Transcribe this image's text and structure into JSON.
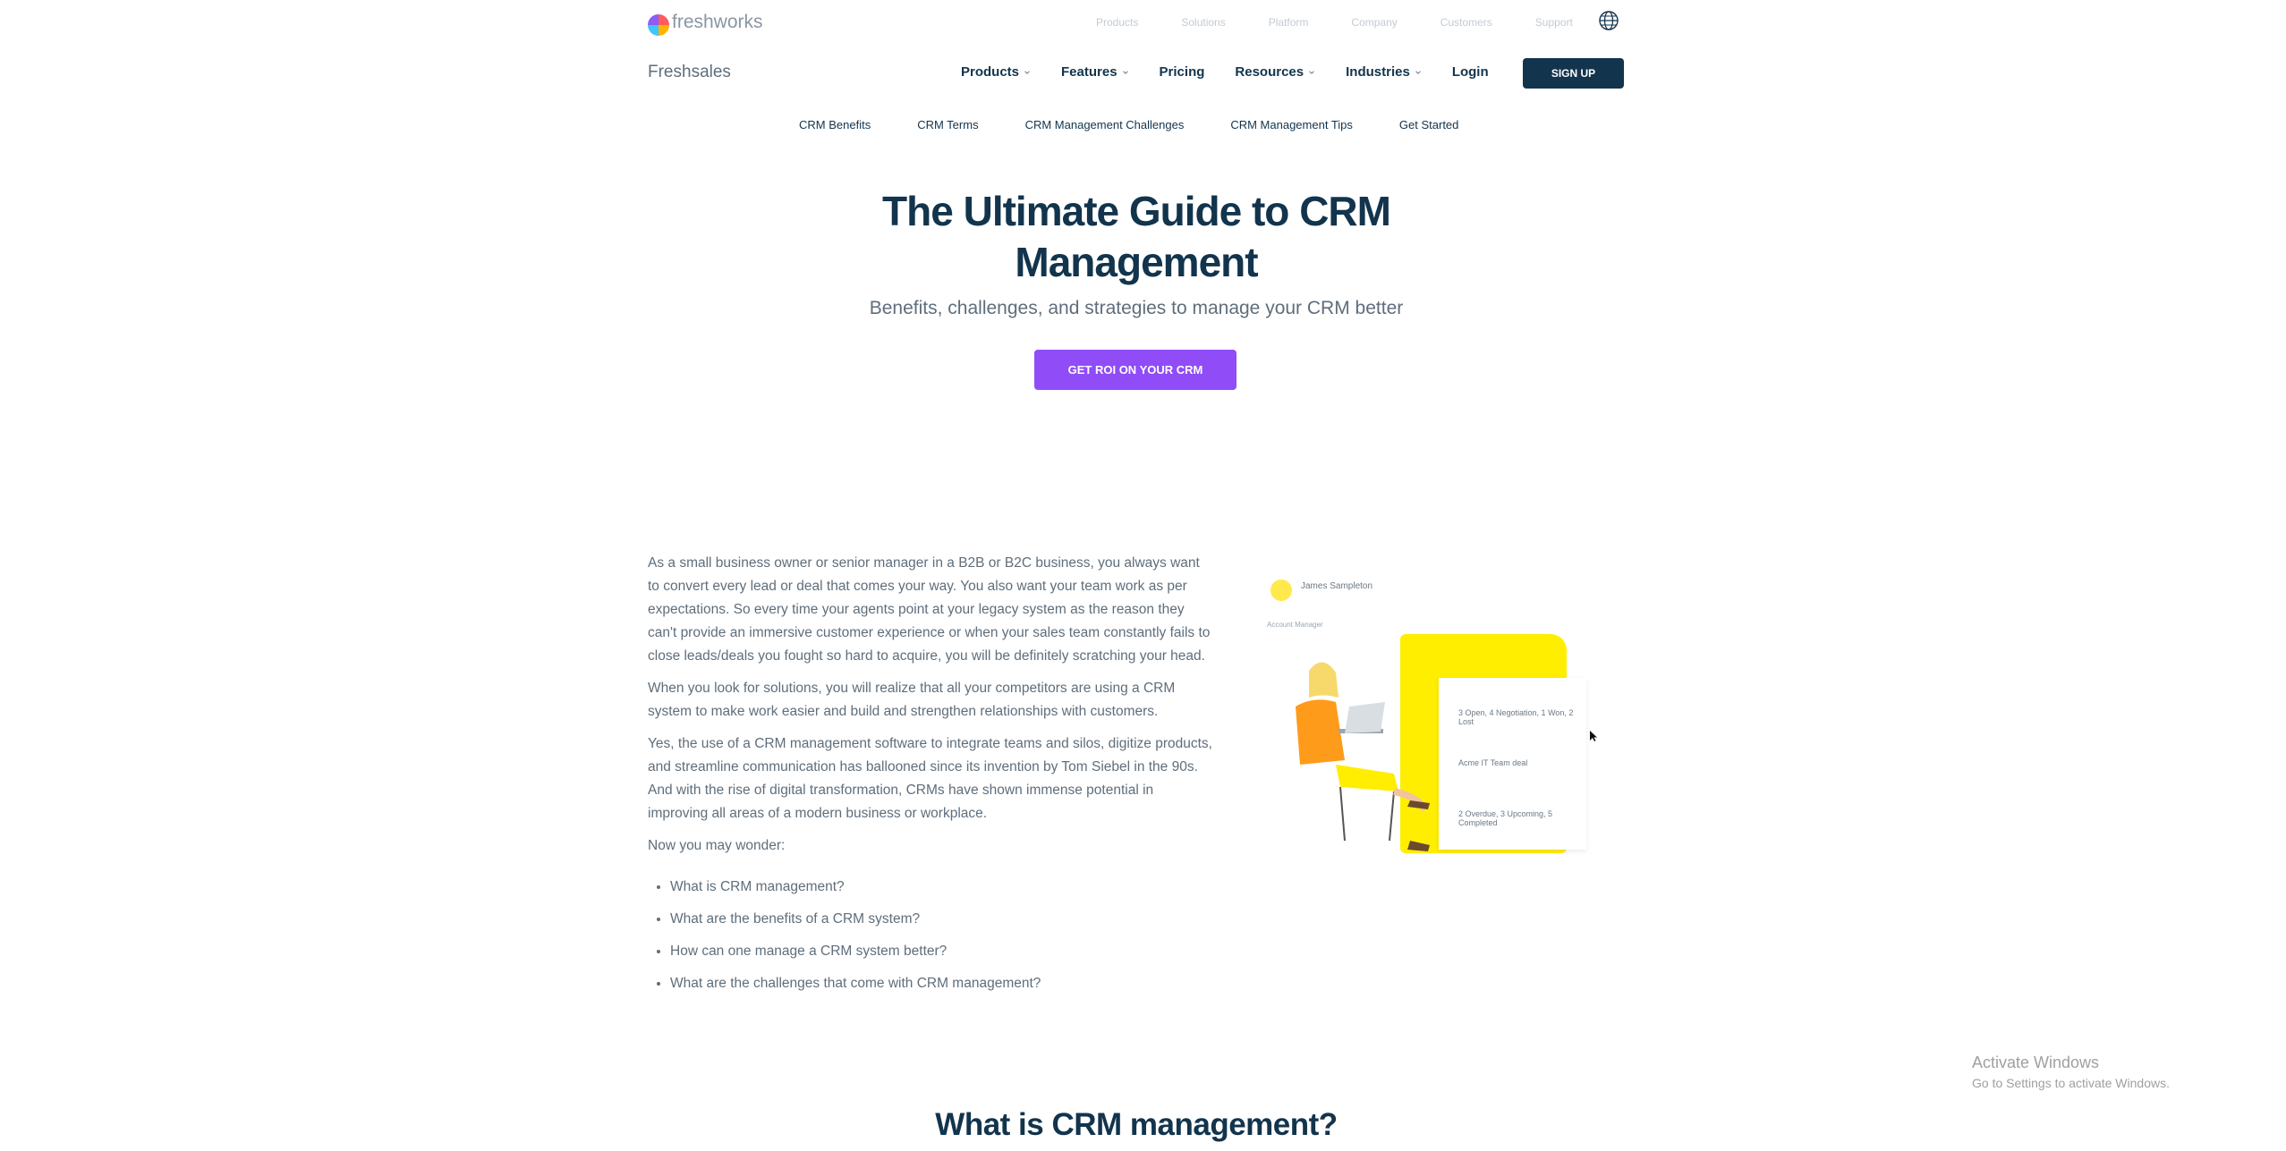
{
  "brand": {
    "name": "freshworks"
  },
  "utility_nav": [
    "Products",
    "Solutions",
    "Platform",
    "Company",
    "Customers",
    "Support"
  ],
  "product_name": "Freshsales",
  "main_nav": {
    "items": [
      {
        "label": "Products",
        "dropdown": true
      },
      {
        "label": "Features",
        "dropdown": true
      },
      {
        "label": "Pricing",
        "dropdown": false
      },
      {
        "label": "Resources",
        "dropdown": true
      },
      {
        "label": "Industries",
        "dropdown": true
      },
      {
        "label": "Login",
        "dropdown": false
      }
    ],
    "signup_label": "SIGN UP"
  },
  "sub_nav": [
    "CRM Benefits",
    "CRM Terms",
    "CRM Management Challenges",
    "CRM Management Tips",
    "Get Started"
  ],
  "hero": {
    "title_line1": "The Ultimate Guide to CRM",
    "title_line2": "Management",
    "subtitle": "Benefits, challenges, and strategies to manage your CRM better",
    "cta_label": "GET ROI ON YOUR CRM"
  },
  "body": {
    "paragraphs": [
      "As a small business owner or senior manager in a B2B or B2C business, you always want to convert every lead or deal that comes your way. You also want your team work as per expectations. So every time your agents point at your legacy system as the reason they can't provide an immersive customer experience or when your sales team constantly fails to close leads/deals you fought so hard to acquire, you will be definitely scratching your head.",
      "When you look for solutions, you will realize that all your competitors are using a CRM system to make work easier and build and strengthen relationships with customers.",
      "Yes, the use of a CRM management software to integrate teams and silos, digitize products, and streamline communication has ballooned since its invention by Tom Siebel in the 90s. And with the rise of digital transformation, CRMs have shown immense potential in improving all areas of a modern business or workplace.",
      "Now you may wonder:"
    ],
    "questions": [
      "What is CRM management?",
      "What are the benefits of a CRM system?",
      "How can one manage a CRM system better?",
      "What are the challenges that come with CRM management?"
    ]
  },
  "illustration": {
    "user_name": "James Sampleton",
    "label": "Account Manager",
    "stat1": "3 Open, 4 Negotiation, 1 Won, 2 Lost",
    "stat2": "Acme IT Team deal",
    "stat3": "2 Overdue, 3 Upcoming, 5 Completed"
  },
  "section_title": "What is CRM management?",
  "watermark": {
    "title": "Activate Windows",
    "subtitle": "Go to Settings to activate Windows."
  },
  "colors": {
    "primary": "#12344d",
    "cta": "#8f4cf7",
    "accent_yellow": "#ffee00",
    "muted_text": "#5f6e7b"
  },
  "icons": [
    "freshworks-logo-icon",
    "globe-icon",
    "chevron-down-icon",
    "cursor-icon"
  ]
}
